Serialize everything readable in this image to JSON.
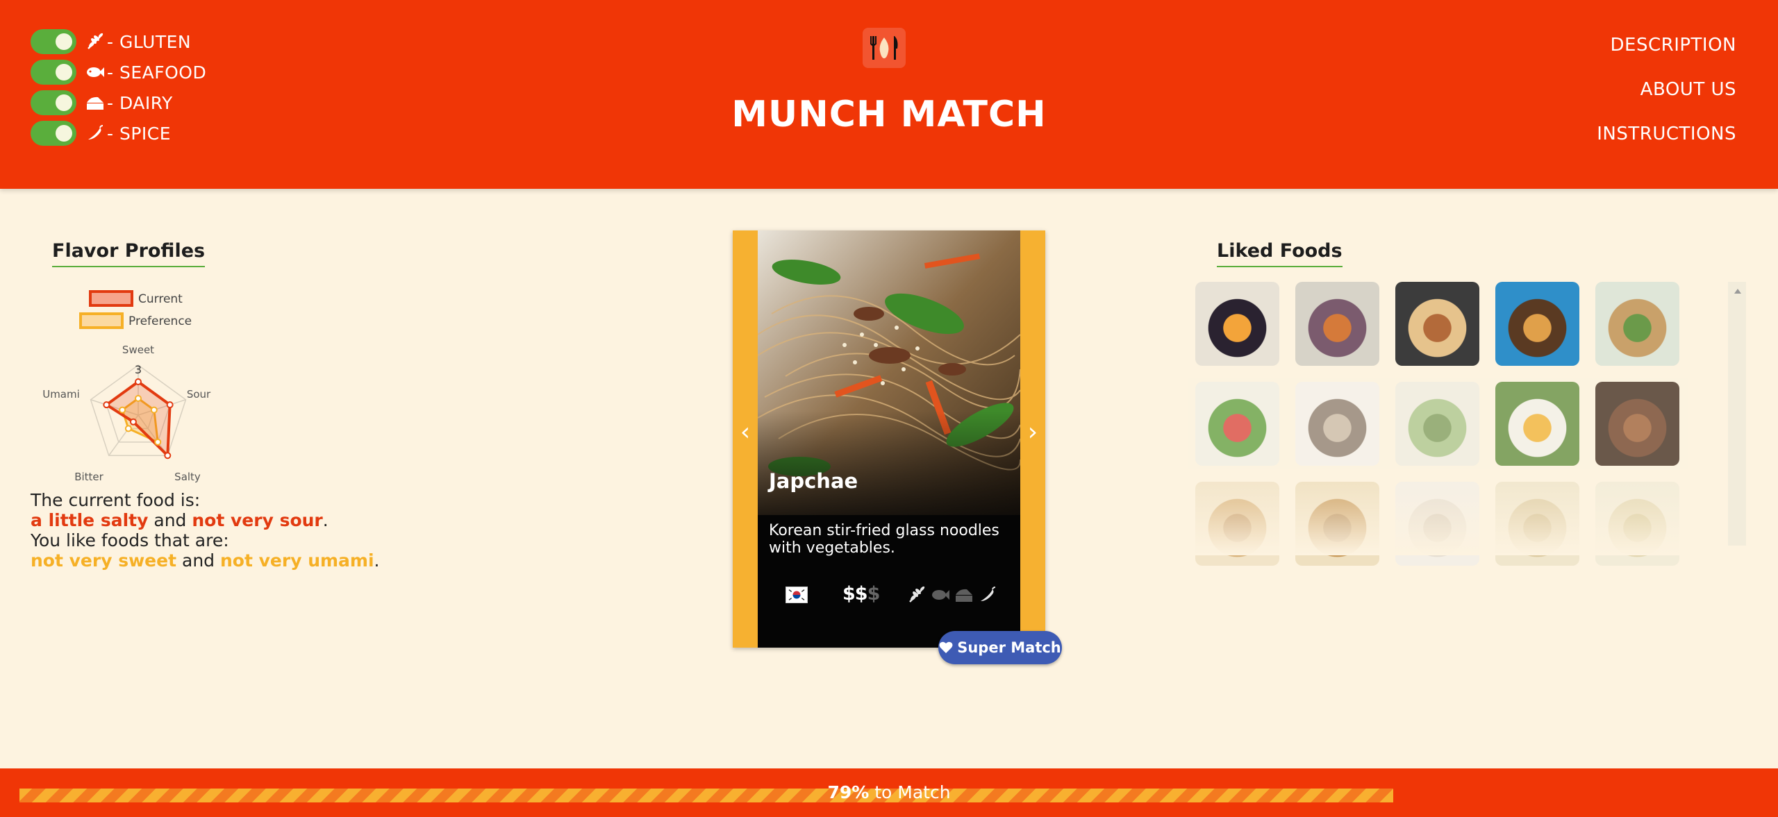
{
  "header": {
    "title": "MUNCH MATCH",
    "logo_icon": "fork-knife-flame-icon",
    "toggles": [
      {
        "label": "- GLUTEN",
        "icon": "wheat-icon",
        "on": true
      },
      {
        "label": "- SEAFOOD",
        "icon": "fish-icon",
        "on": true
      },
      {
        "label": "- DAIRY",
        "icon": "cheese-icon",
        "on": true
      },
      {
        "label": "- SPICE",
        "icon": "chili-pepper-icon",
        "on": true
      }
    ],
    "nav": [
      "DESCRIPTION",
      "ABOUT US",
      "INSTRUCTIONS"
    ]
  },
  "flavor": {
    "title": "Flavor Profiles",
    "legend": {
      "current": "Current",
      "preference": "Preference"
    },
    "axes": [
      "Sweet",
      "Sour",
      "Salty",
      "Bitter",
      "Umami"
    ],
    "scale_label": "3",
    "scale_max": 3,
    "current": [
      2,
      2,
      3,
      0.5,
      2
    ],
    "preference": [
      1,
      1,
      2,
      1,
      1
    ],
    "colors": {
      "current": "#e23a10",
      "preference": "#f6b026"
    },
    "summary": {
      "line1": "The current food is:",
      "current_a": "a little salty",
      "and1": " and ",
      "current_b": "not very sour",
      "period1": ".",
      "line2": "You like foods that are:",
      "pref_a": "not very sweet",
      "and2": " and ",
      "pref_b": "not very umami",
      "period2": "."
    }
  },
  "card": {
    "name": "Japchae",
    "description": "Korean stir-fried glass noodles with vegetables.",
    "price_active": "$$",
    "price_inactive": "$",
    "country_flag": "south-korea-flag-icon",
    "allergens": [
      {
        "icon": "wheat-icon",
        "active": true
      },
      {
        "icon": "fish-icon",
        "active": false
      },
      {
        "icon": "cheese-icon",
        "active": false
      },
      {
        "icon": "chili-pepper-icon",
        "active": true
      }
    ],
    "prev_arrow": "‹",
    "next_arrow": "›",
    "super_match_label": "Super Match"
  },
  "liked": {
    "title": "Liked Foods",
    "items": [
      "black-dessert-bowl-thumbnail",
      "purple-stew-thumbnail",
      "layered-casserole-thumbnail",
      "mushroom-pan-thumbnail",
      "noodle-salad-thumbnail",
      "avocado-salad-thumbnail",
      "sesame-cake-squares-thumbnail",
      "green-curry-thumbnail",
      "mango-sticky-rice-thumbnail",
      "braised-pork-thumbnail",
      "soup-bowl-thumbnail",
      "fried-dish-thumbnail",
      "white-dessert-thumbnail",
      "rice-plate-thumbnail",
      "cream-soup-thumbnail"
    ]
  },
  "progress": {
    "percent": 79,
    "percent_label": "79%",
    "suffix": " to Match"
  }
}
